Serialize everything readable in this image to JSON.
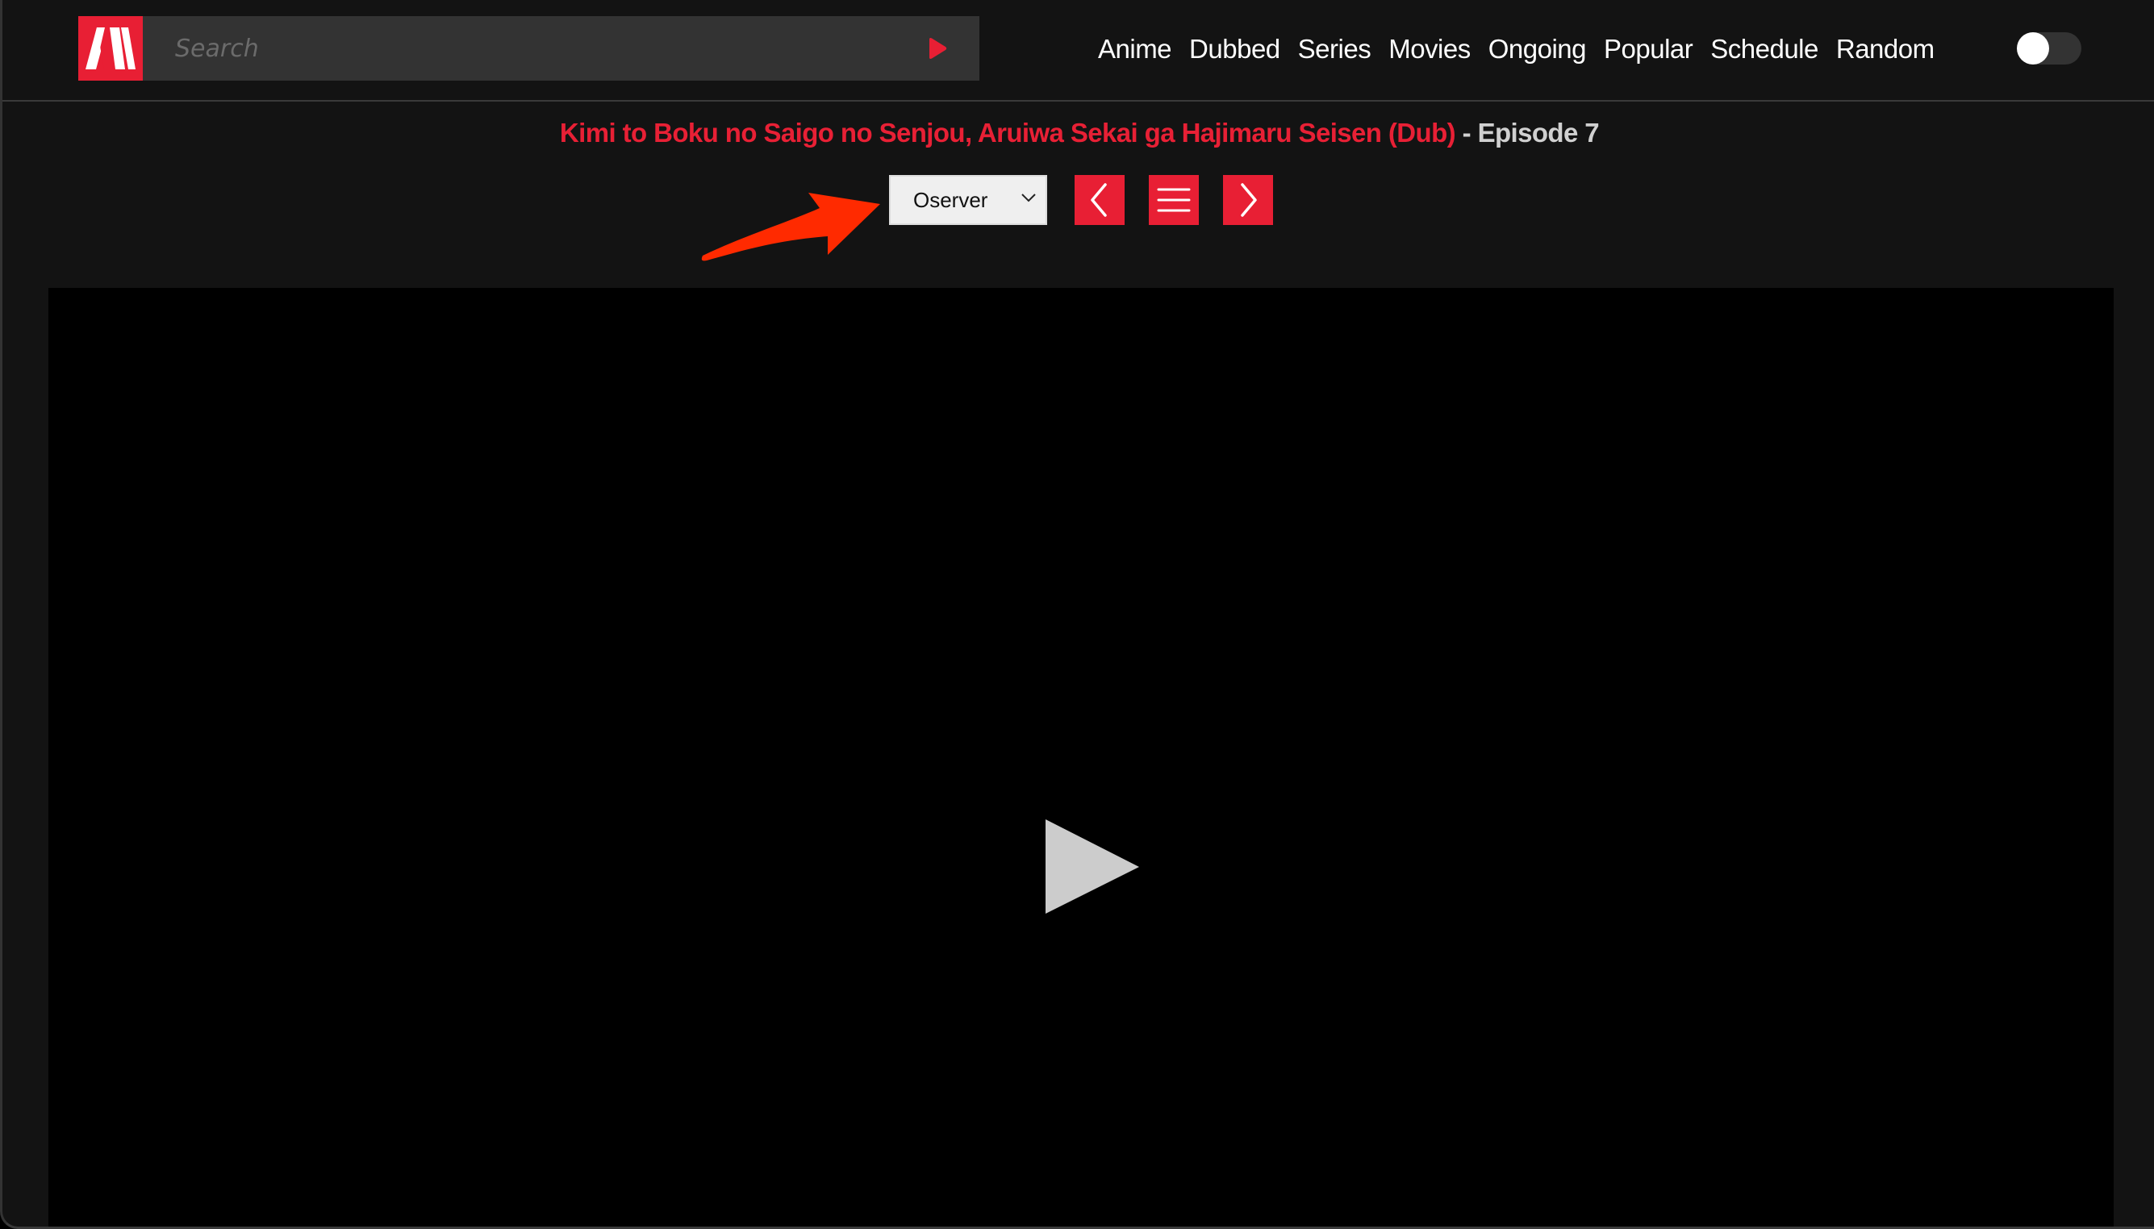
{
  "header": {
    "logo_alt": "Site logo",
    "search": {
      "placeholder": "Search",
      "value": "",
      "submit_icon": "play-triangle-icon"
    },
    "nav": [
      {
        "label": "Anime"
      },
      {
        "label": "Dubbed"
      },
      {
        "label": "Series"
      },
      {
        "label": "Movies"
      },
      {
        "label": "Ongoing"
      },
      {
        "label": "Popular"
      },
      {
        "label": "Schedule"
      },
      {
        "label": "Random"
      }
    ],
    "theme_toggle": {
      "state": "off"
    }
  },
  "episode": {
    "series_title": "Kimi to Boku no Saigo no Senjou, Aruiwa Sekai ga Hajimaru Seisen (Dub)",
    "separator_episode": " - Episode 7"
  },
  "controls": {
    "server_select": {
      "selected": "Oserver"
    },
    "prev_icon": "chevron-left-icon",
    "list_icon": "menu-icon",
    "next_icon": "chevron-right-icon"
  },
  "player": {
    "play_icon": "play-icon"
  },
  "colors": {
    "accent": "#e81f34",
    "background": "#131313",
    "search_bg": "#333333",
    "annotation_arrow": "#ff2a00",
    "episode_text": "#d0d0d0",
    "play_icon": "#cccccc"
  }
}
